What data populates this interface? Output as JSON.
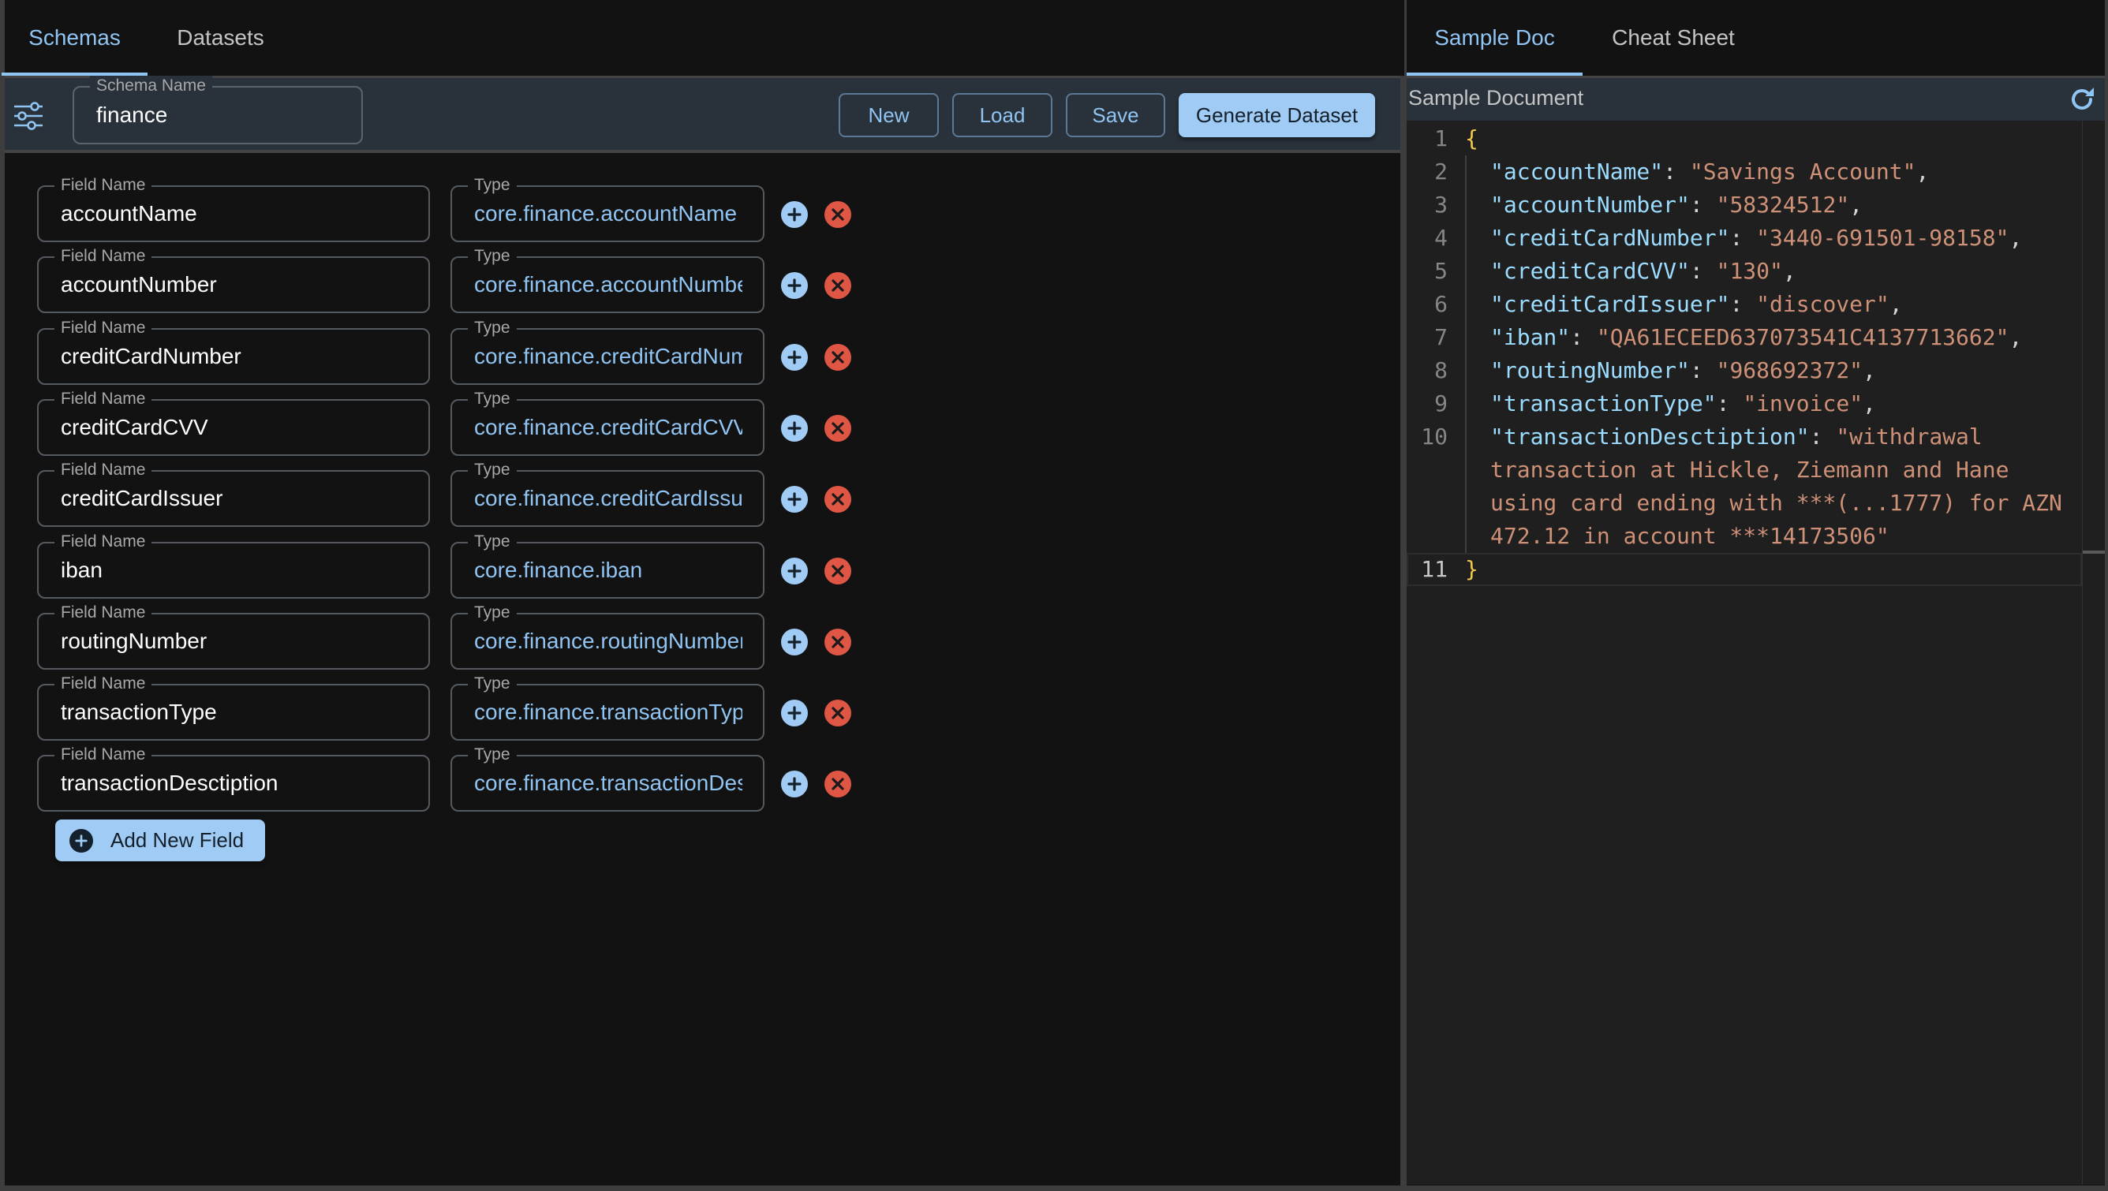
{
  "left_tabs": [
    {
      "label": "Schemas",
      "active": true
    },
    {
      "label": "Datasets",
      "active": false
    }
  ],
  "toolbar": {
    "filter_icon": "sliders-icon",
    "schema_name_label": "Schema Name",
    "schema_name_value": "finance",
    "new_label": "New",
    "load_label": "Load",
    "save_label": "Save",
    "generate_label": "Generate Dataset"
  },
  "fields": [
    {
      "name_label": "Field Name",
      "name": "accountName",
      "type_label": "Type",
      "type": "core.finance.accountName"
    },
    {
      "name_label": "Field Name",
      "name": "accountNumber",
      "type_label": "Type",
      "type": "core.finance.accountNumber"
    },
    {
      "name_label": "Field Name",
      "name": "creditCardNumber",
      "type_label": "Type",
      "type": "core.finance.creditCardNumber"
    },
    {
      "name_label": "Field Name",
      "name": "creditCardCVV",
      "type_label": "Type",
      "type": "core.finance.creditCardCVV"
    },
    {
      "name_label": "Field Name",
      "name": "creditCardIssuer",
      "type_label": "Type",
      "type": "core.finance.creditCardIssuer"
    },
    {
      "name_label": "Field Name",
      "name": "iban",
      "type_label": "Type",
      "type": "core.finance.iban"
    },
    {
      "name_label": "Field Name",
      "name": "routingNumber",
      "type_label": "Type",
      "type": "core.finance.routingNumber"
    },
    {
      "name_label": "Field Name",
      "name": "transactionType",
      "type_label": "Type",
      "type": "core.finance.transactionType"
    },
    {
      "name_label": "Field Name",
      "name": "transactionDesctiption",
      "type_label": "Type",
      "type": "core.finance.transactionDescription"
    }
  ],
  "add_field_label": "Add New Field",
  "right_tabs": [
    {
      "label": "Sample Doc",
      "active": true
    },
    {
      "label": "Cheat Sheet",
      "active": false
    }
  ],
  "sample_doc": {
    "title": "Sample Document",
    "refresh_icon": "refresh-icon",
    "entries": [
      {
        "key": "accountName",
        "value": "Savings Account"
      },
      {
        "key": "accountNumber",
        "value": "58324512"
      },
      {
        "key": "creditCardNumber",
        "value": "3440-691501-98158"
      },
      {
        "key": "creditCardCVV",
        "value": "130"
      },
      {
        "key": "creditCardIssuer",
        "value": "discover"
      },
      {
        "key": "iban",
        "value": "QA61ECEED637073541C4137713662"
      },
      {
        "key": "routingNumber",
        "value": "968692372"
      },
      {
        "key": "transactionType",
        "value": "invoice"
      },
      {
        "key": "transactionDesctiption",
        "value": "withdrawal transaction at Hickle, Ziemann and Hane using card ending with ***(...1777) for AZN 472.12 in account ***14173506"
      }
    ]
  },
  "colors": {
    "accent": "#90c4f2",
    "primary_button": "#9fcbf4",
    "delete": "#df5645",
    "toolbar_bg": "#29313a",
    "app_bg": "#121212",
    "editor_bg": "#1f1f1f"
  }
}
